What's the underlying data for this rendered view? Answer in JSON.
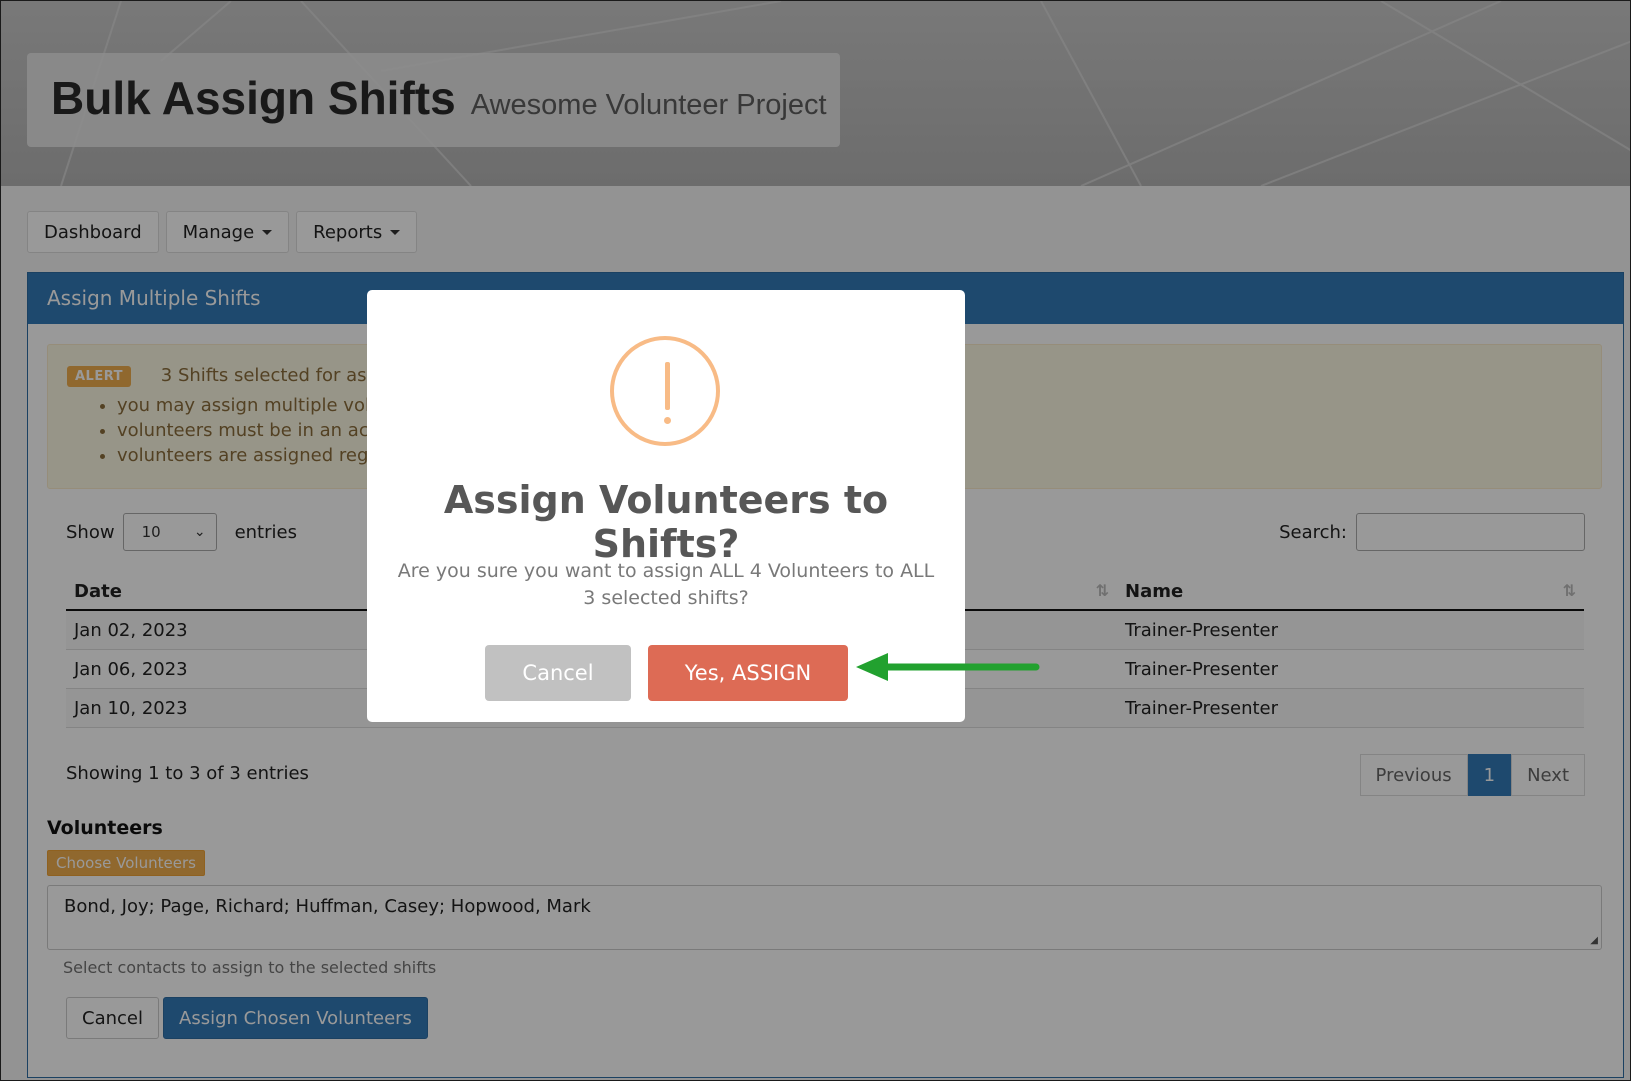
{
  "header": {
    "title": "Bulk Assign Shifts",
    "subtitle": "Awesome Volunteer Project"
  },
  "nav": {
    "dashboard": "Dashboard",
    "manage": "Manage",
    "reports": "Reports"
  },
  "panel": {
    "heading": "Assign Multiple Shifts",
    "alert": {
      "label": "ALERT",
      "message": "3 Shifts selected for ass",
      "bullets": [
        "you may assign multiple volu",
        "volunteers must be in an acc",
        "volunteers are assigned rega"
      ]
    },
    "table_controls": {
      "show_label": "Show",
      "page_size": "10",
      "entries_label": "entries",
      "search_label": "Search:"
    },
    "table": {
      "headers": [
        "Date",
        "Name"
      ],
      "rows": [
        [
          "Jan 02, 2023",
          "Trainer-Presenter"
        ],
        [
          "Jan 06, 2023",
          "Trainer-Presenter"
        ],
        [
          "Jan 10, 2023",
          "Trainer-Presenter"
        ]
      ]
    },
    "info": "Showing 1 to 3 of 3 entries",
    "pagination": {
      "previous": "Previous",
      "current": "1",
      "next": "Next"
    },
    "volunteers": {
      "heading": "Volunteers",
      "choose_button": "Choose Volunteers",
      "value": "Bond, Joy; Page, Richard; Huffman, Casey; Hopwood, Mark",
      "help": "Select contacts to assign to the selected shifts"
    },
    "actions": {
      "cancel": "Cancel",
      "assign": "Assign Chosen Volunteers"
    }
  },
  "modal": {
    "icon": "warning-icon",
    "title": "Assign Volunteers to Shifts?",
    "text": "Are you sure you want to assign ALL 4 Volunteers to ALL 3 selected shifts?",
    "cancel": "Cancel",
    "confirm": "Yes, ASSIGN"
  },
  "colors": {
    "primary": "#337ab7",
    "warning": "#f0ad4e",
    "confirm": "#dd6b55",
    "arrow": "#22a12f"
  }
}
